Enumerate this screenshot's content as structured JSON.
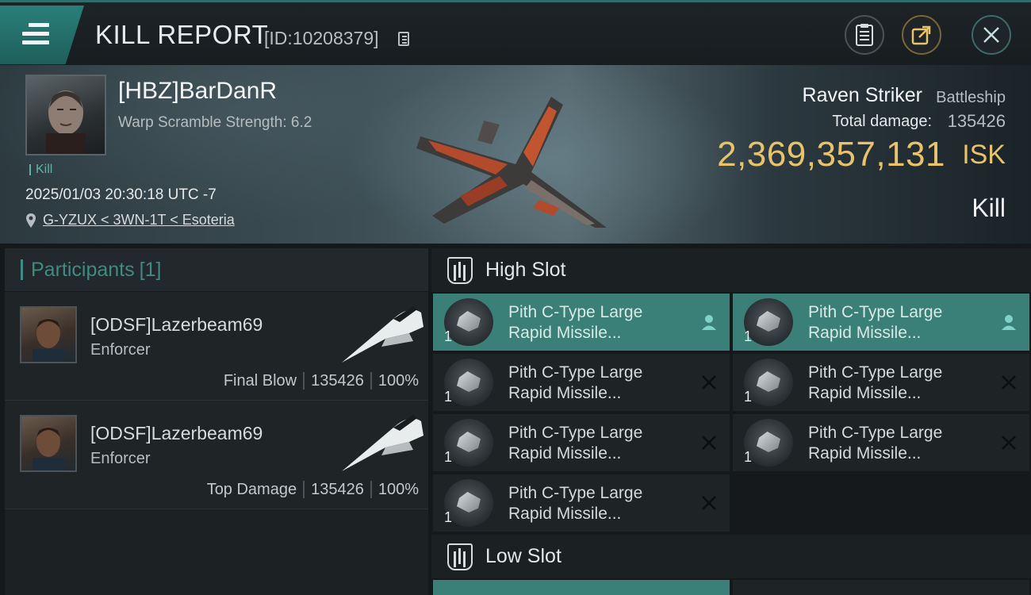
{
  "header": {
    "title": "KILL REPORT",
    "report_id": "[ID:10208379]"
  },
  "victim": {
    "name": "[HBZ]BarDanR",
    "warp_scramble": "Warp Scramble Strength: 6.2",
    "tag": "Kill",
    "timestamp": "2025/01/03 20:30:18 UTC -7",
    "location": "G-YZUX < 3WN-1T < Esoteria",
    "ship_name": "Raven Striker",
    "ship_class": "Battleship",
    "total_damage_label": "Total damage:",
    "total_damage": "135426",
    "isk_value": "2,369,357,131",
    "isk_unit": "ISK",
    "result": "Kill"
  },
  "participants": {
    "title": "Participants",
    "count": "[1]",
    "items": [
      {
        "name": "[ODSF]Lazerbeam69",
        "ship": "Enforcer",
        "role": "Final Blow",
        "damage": "135426",
        "percent": "100%"
      },
      {
        "name": "[ODSF]Lazerbeam69",
        "ship": "Enforcer",
        "role": "Top Damage",
        "damage": "135426",
        "percent": "100%"
      }
    ]
  },
  "slots": {
    "high_label": "High Slot",
    "low_label": "Low Slot",
    "modules": [
      {
        "line1": "Pith C-Type Large",
        "line2": "Rapid Missile...",
        "qty": "1",
        "status": "dropped"
      },
      {
        "line1": "Pith C-Type Large",
        "line2": "Rapid Missile...",
        "qty": "1",
        "status": "dropped"
      },
      {
        "line1": "Pith C-Type Large",
        "line2": "Rapid Missile...",
        "qty": "1",
        "status": "destroyed"
      },
      {
        "line1": "Pith C-Type Large",
        "line2": "Rapid Missile...",
        "qty": "1",
        "status": "destroyed"
      },
      {
        "line1": "Pith C-Type Large",
        "line2": "Rapid Missile...",
        "qty": "1",
        "status": "destroyed"
      },
      {
        "line1": "Pith C-Type Large",
        "line2": "Rapid Missile...",
        "qty": "1",
        "status": "destroyed"
      },
      {
        "line1": "Pith C-Type Large",
        "line2": "Rapid Missile...",
        "qty": "1",
        "status": "destroyed"
      }
    ]
  },
  "colors": {
    "accent": "#3b7f79",
    "isk_gold": "#e8c36b",
    "kill_green": "#5fb3a6"
  },
  "icons": [
    "menu-icon",
    "copy-icon",
    "clipboard-icon",
    "share-icon",
    "close-icon",
    "location-pin-icon",
    "high-slot-icon",
    "low-slot-icon",
    "pilot-icon",
    "destroyed-x-icon"
  ]
}
